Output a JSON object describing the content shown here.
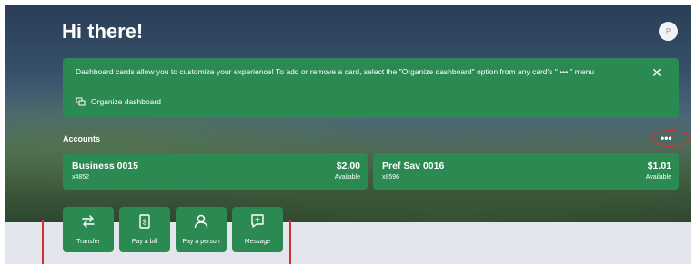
{
  "greeting": "Hi there!",
  "avatar_initial": "P",
  "banner": {
    "message": "Dashboard cards allow you to customize your experience! To add or remove a card, select the \"Organize dashboard\" option from any card's \" ••• \" menu",
    "close": "✕",
    "organize_label": "Organize dashboard"
  },
  "accounts": {
    "title": "Accounts",
    "menu": "•••",
    "cards": [
      {
        "name": "Business 0015",
        "number": "x4852",
        "amount": "$2.00",
        "available": "Available"
      },
      {
        "name": "Pref Sav 0016",
        "number": "x8596",
        "amount": "$1.01",
        "available": "Available"
      }
    ]
  },
  "actions": [
    {
      "label": "Transfer",
      "icon": "transfer-icon"
    },
    {
      "label": "Pay a bill",
      "icon": "bill-icon"
    },
    {
      "label": "Pay a person",
      "icon": "person-icon"
    },
    {
      "label": "Message",
      "icon": "message-icon"
    }
  ],
  "colors": {
    "card_green": "#2a8a52",
    "annotation_red": "#e03030"
  }
}
